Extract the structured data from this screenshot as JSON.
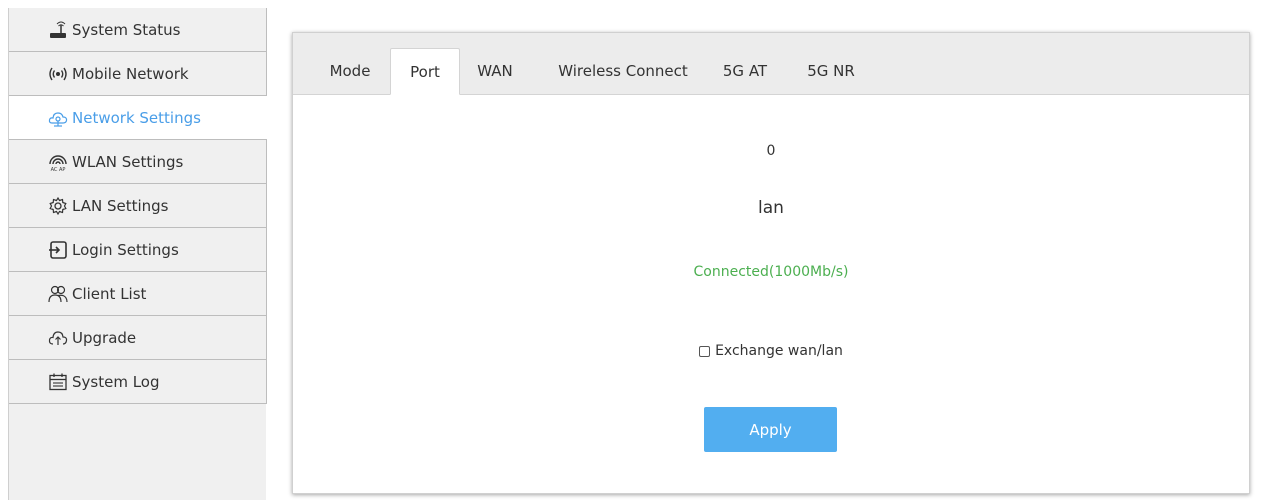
{
  "sidebar": {
    "items": [
      {
        "label": "System Status",
        "icon": "router-icon",
        "active": false
      },
      {
        "label": "Mobile Network",
        "icon": "signal-icon",
        "active": false
      },
      {
        "label": "Network Settings",
        "icon": "network-icon",
        "active": true
      },
      {
        "label": "WLAN Settings",
        "icon": "wifi-icon",
        "active": false
      },
      {
        "label": "LAN Settings",
        "icon": "gear-icon",
        "active": false
      },
      {
        "label": "Login Settings",
        "icon": "login-icon",
        "active": false
      },
      {
        "label": "Client List",
        "icon": "users-icon",
        "active": false
      },
      {
        "label": "Upgrade",
        "icon": "upload-cloud-icon",
        "active": false
      },
      {
        "label": "System Log",
        "icon": "calendar-log-icon",
        "active": false
      }
    ],
    "active_color": "#4a9ee8"
  },
  "tabs": [
    {
      "label": "Mode",
      "active": false
    },
    {
      "label": "Port",
      "active": true
    },
    {
      "label": "WAN",
      "active": false
    },
    {
      "label": "Wireless Connect",
      "active": false
    },
    {
      "label": "5G AT",
      "active": false
    },
    {
      "label": "5G NR",
      "active": false
    }
  ],
  "port": {
    "number": "0",
    "name": "lan",
    "status": "Connected(1000Mb/s)",
    "status_color": "#4caf50"
  },
  "exchange": {
    "label": "Exchange wan/lan",
    "checked": false
  },
  "apply_label": "Apply",
  "apply_color": "#52aef0"
}
